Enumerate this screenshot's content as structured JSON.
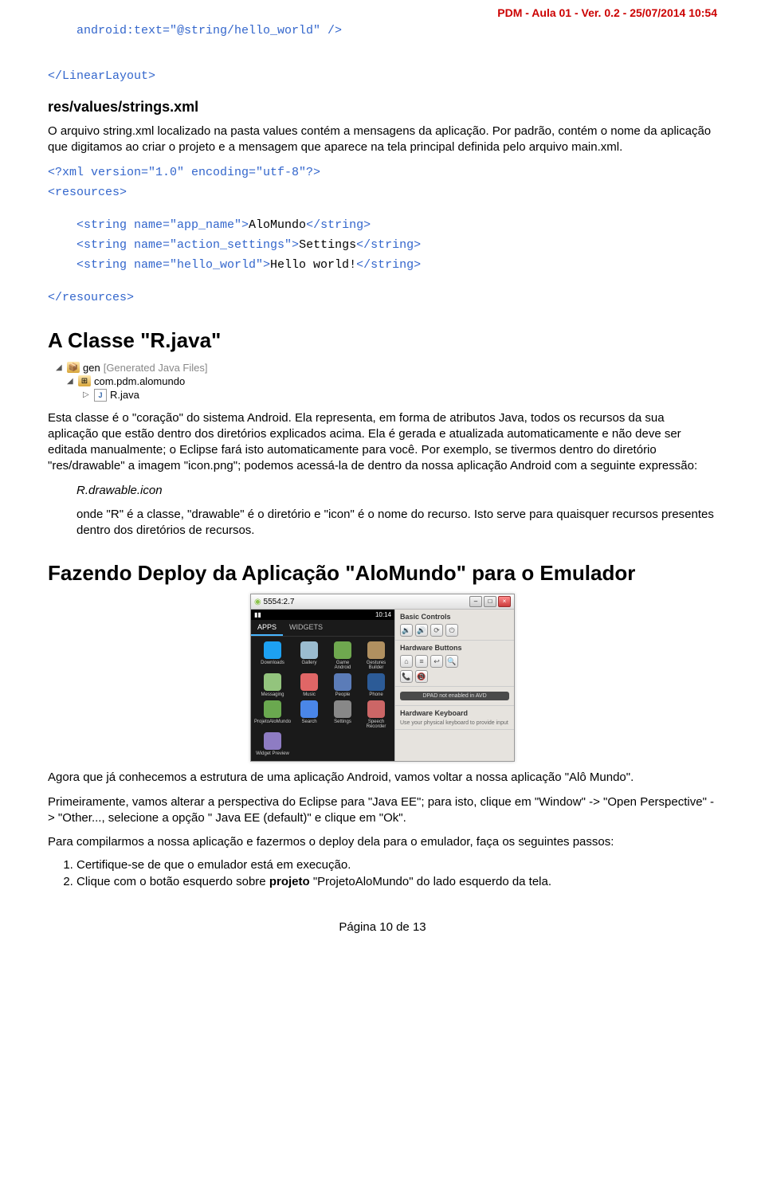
{
  "header": "PDM - Aula 01 - Ver. 0.2 - 25/07/2014 10:54",
  "code_line1": "android:text=\"@string/hello_world\" />",
  "code_line2": "</LinearLayout>",
  "file_heading": "res/values/strings.xml",
  "para1": "O arquivo string.xml localizado na pasta values contém a mensagens da aplicação. Por padrão, contém o nome da aplicação que digitamos ao criar o projeto e a mensagem que aparece na tela principal definida pelo arquivo main.xml.",
  "xml_decl": "<?xml version=\"1.0\" encoding=\"utf-8\"?>",
  "res_open": "<resources>",
  "res_s1a": "    <string name=\"app_name\">",
  "res_s1b": "AloMundo",
  "res_s1c": "</string>",
  "res_s2a": "    <string name=\"action_settings\">",
  "res_s2b": "Settings",
  "res_s2c": "</string>",
  "res_s3a": "    <string name=\"hello_world\">",
  "res_s3b": "Hello world!",
  "res_s3c": "</string>",
  "res_close": "</resources>",
  "h_rjava": "A Classe \"R.java\"",
  "tree": {
    "gen": "gen",
    "gen_hint": "[Generated Java Files]",
    "pkg": "com.pdm.alomundo",
    "file": "R.java"
  },
  "para2": "Esta classe é o \"coração\" do sistema Android. Ela representa, em forma de atributos Java, todos os recursos da sua aplicação que estão dentro dos diretórios explicados acima. Ela é gerada e atualizada automaticamente e não deve ser editada manualmente; o Eclipse fará isto automaticamente para você. Por exemplo, se tivermos dentro do diretório \"res/drawable\" a imagem \"icon.png\"; podemos acessá-la de dentro da nossa aplicação Android com a seguinte expressão:",
  "expr": "R.drawable.icon",
  "para3": "onde \"R\" é a classe, \"drawable\" é o diretório e \"icon\" é o nome do recurso. Isto serve para quaisquer recursos presentes dentro dos diretórios de recursos.",
  "h_deploy": "Fazendo Deploy da Aplicação \"AloMundo\" para o Emulador",
  "emulator": {
    "title": "5554:2.7",
    "time": "10:14",
    "tab_apps": "APPS",
    "tab_widgets": "WIDGETS",
    "apps": [
      "Downloads",
      "Gallery",
      "Game Android",
      "Gestures Builder",
      "Messaging",
      "Music",
      "People",
      "Phone",
      "ProjetoAloMundo",
      "Search",
      "Settings",
      "Speech Recorder",
      "Widget Preview"
    ],
    "colors": [
      "#1da1f2",
      "#9bbccf",
      "#6fa84f",
      "#b09060",
      "#93c47d",
      "#e06666",
      "#5b7cb8",
      "#2c5b97",
      "#6aa84f",
      "#4a86e8",
      "#888",
      "#cc6666",
      "#8e7cc3"
    ],
    "side_basic": "Basic Controls",
    "side_hw": "Hardware Buttons",
    "side_dpad": "DPAD not enabled in AVD",
    "side_kb_t": "Hardware Keyboard",
    "side_kb_s": "Use your physical keyboard to provide input"
  },
  "para4": "Agora que já conhecemos a estrutura de uma aplicação Android, vamos voltar a nossa aplicação \"Alô Mundo\".",
  "para5": "Primeiramente, vamos alterar a perspectiva do Eclipse para \"Java EE\"; para isto, clique em \"Window\" -> \"Open Perspective\" -> \"Other..., selecione a opção \" Java EE (default)\" e clique em \"Ok\".",
  "para6": "Para compilarmos a nossa aplicação e fazermos o deploy dela para o emulador, faça os seguintes passos:",
  "steps": {
    "s1": "Certifique-se de que o emulador está em execução.",
    "s2a": "Clique com o botão esquerdo sobre ",
    "s2b": "projeto",
    "s2c": " \"ProjetoAloMundo\" do lado esquerdo da tela."
  },
  "footer": "Página 10 de 13"
}
